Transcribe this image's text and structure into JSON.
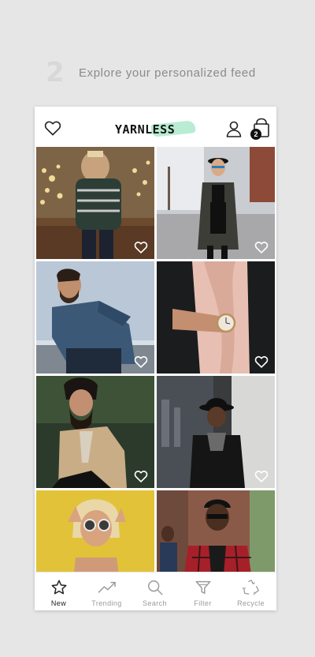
{
  "step": {
    "number": "2",
    "text": "Explore your personalized feed"
  },
  "app": {
    "logo": "YARNLESS",
    "cart_count": "2"
  },
  "colors": {
    "background": "#e6e6e6",
    "accent": "#b9ecd3",
    "badge": "#111111"
  },
  "feed": {
    "photos": [
      {
        "alt": "woman in striped sweater with string lights"
      },
      {
        "alt": "woman in hat and long coat on street"
      },
      {
        "alt": "bearded man in denim shirt"
      },
      {
        "alt": "wrist watch with leather jacket and pink top"
      },
      {
        "alt": "bearded man in beige blazer"
      },
      {
        "alt": "man in hat and black jacket"
      },
      {
        "alt": "woman with sunglasses on yellow background"
      },
      {
        "alt": "man in plaid shirt and sunglasses"
      }
    ]
  },
  "tabs": [
    {
      "label": "New",
      "icon": "star-icon",
      "active": true
    },
    {
      "label": "Trending",
      "icon": "trending-icon",
      "active": false
    },
    {
      "label": "Search",
      "icon": "search-icon",
      "active": false
    },
    {
      "label": "Filter",
      "icon": "filter-icon",
      "active": false
    },
    {
      "label": "Recycle",
      "icon": "recycle-icon",
      "active": false
    }
  ]
}
